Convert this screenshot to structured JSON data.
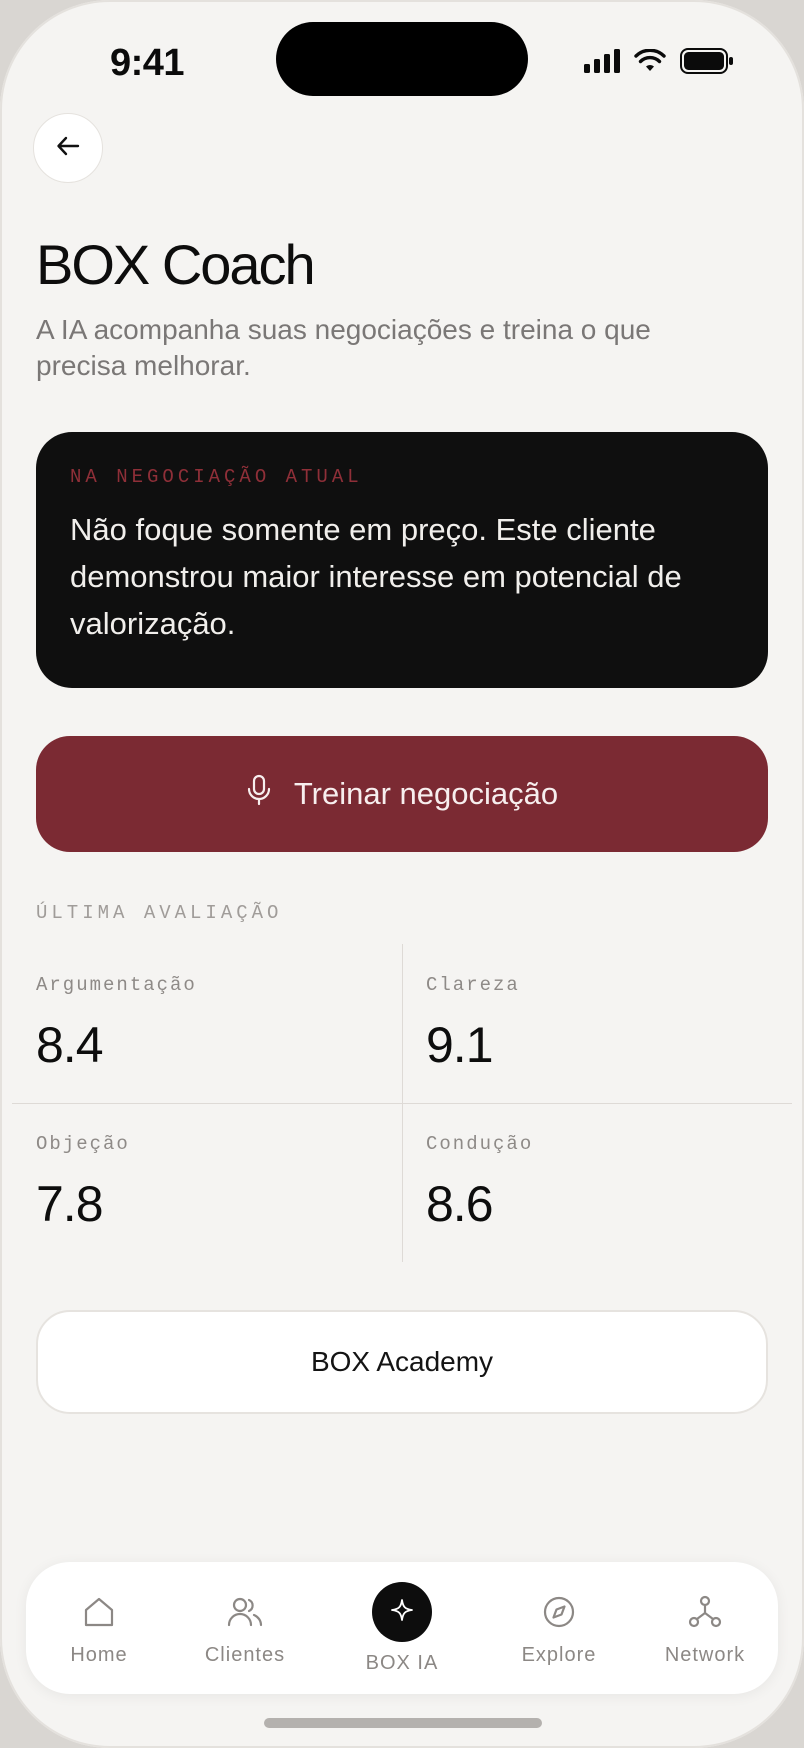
{
  "status_bar": {
    "time": "9:41"
  },
  "header": {
    "title": "BOX Coach",
    "subtitle": "A IA acompanha suas negociações e treina o que precisa melhorar."
  },
  "coach_card": {
    "label": "NA NEGOCIAÇÃO ATUAL",
    "text": "Não foque somente em preço. Este cliente demonstrou maior interesse em potencial de valorização."
  },
  "train_button": {
    "label": "Treinar negociação",
    "icon": "microphone-icon"
  },
  "evaluation": {
    "section_label": "ÚLTIMA AVALIAÇÃO",
    "metrics": [
      {
        "name": "Argumentação",
        "value": "8.4"
      },
      {
        "name": "Clareza",
        "value": "9.1"
      },
      {
        "name": "Objeção",
        "value": "7.8"
      },
      {
        "name": "Condução",
        "value": "8.6"
      }
    ]
  },
  "academy_button": {
    "label": "BOX Academy"
  },
  "tabbar": {
    "items": [
      {
        "label": "Home",
        "icon": "home-icon"
      },
      {
        "label": "Clientes",
        "icon": "users-icon"
      },
      {
        "label": "BOX IA",
        "icon": "sparkle-icon"
      },
      {
        "label": "Explore",
        "icon": "compass-icon"
      },
      {
        "label": "Network",
        "icon": "network-icon"
      }
    ]
  },
  "colors": {
    "background": "#f5f4f2",
    "card_dark": "#0f0f0f",
    "accent": "#7b2a33",
    "accent_label": "#8f2f38"
  }
}
